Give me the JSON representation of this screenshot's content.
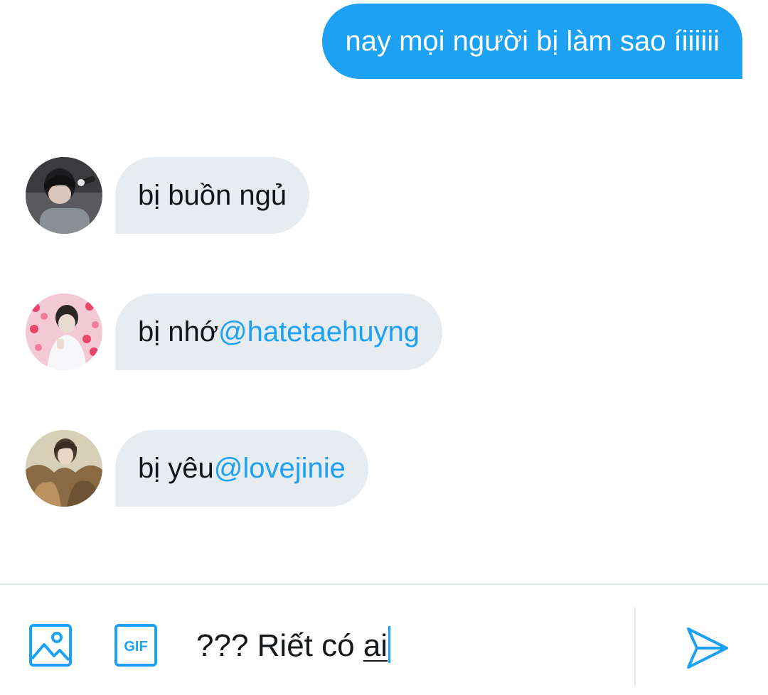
{
  "colors": {
    "accent": "#1da1f2",
    "incoming_bubble": "#e6ecf0",
    "text": "#14171a",
    "divider": "#e1e8ed"
  },
  "messages": [
    {
      "direction": "outgoing",
      "text": "nay mọi người bị làm sao íiiiiii"
    },
    {
      "direction": "incoming",
      "text": "bị buồn ngủ",
      "avatar": "user-avatar-1"
    },
    {
      "direction": "incoming",
      "text": "bị nhớ ",
      "mention": "@hatetaehuyng",
      "avatar": "user-avatar-2"
    },
    {
      "direction": "incoming",
      "text": "bị yêu ",
      "mention": "@lovejinie",
      "avatar": "user-avatar-3"
    }
  ],
  "composer": {
    "value_prefix": "??? Riết có ",
    "value_underlined": "ai",
    "media_icon": "image-icon",
    "gif_icon": "gif-icon",
    "gif_label": "GIF",
    "send_icon": "send-icon"
  }
}
